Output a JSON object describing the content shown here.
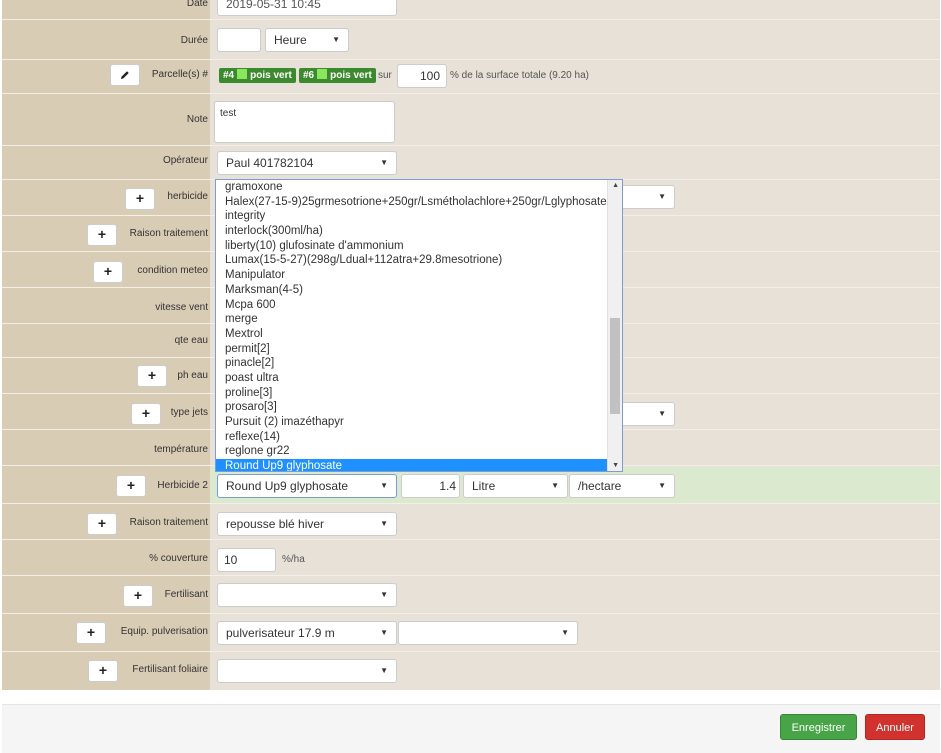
{
  "form": {
    "date": {
      "label": "Date",
      "value": "2019-05-31 10:45"
    },
    "duree": {
      "label": "Durée",
      "value": "",
      "unit": "Heure"
    },
    "parcelles": {
      "label": "Parcelle(s) #",
      "badges": [
        {
          "id": "#4",
          "name": "pois vert"
        },
        {
          "id": "#6",
          "name": "pois vert"
        }
      ],
      "sur": "sur",
      "percent": "100",
      "suffix": "% de la surface totale (9.20 ha)"
    },
    "note": {
      "label": "Note",
      "value": "test"
    },
    "operateur": {
      "label": "Opérateur",
      "value": "Paul 401782104"
    },
    "herbicide": {
      "label": "herbicide"
    },
    "raison1": {
      "label": "Raison traitement"
    },
    "meteo": {
      "label": "condition meteo"
    },
    "vent": {
      "label": "vitesse vent"
    },
    "eau": {
      "label": "qte eau"
    },
    "ph": {
      "label": "ph eau"
    },
    "jets": {
      "label": "type jets"
    },
    "temp": {
      "label": "température"
    },
    "herbicide2": {
      "label": "Herbicide 2",
      "product": "Round Up9 glyphosate",
      "qty": "1.4",
      "unit": "Litre",
      "per": "/hectare"
    },
    "raison2": {
      "label": "Raison traitement",
      "value": "repousse blé hiver"
    },
    "couverture": {
      "label": "% couverture",
      "value": "10",
      "unit": "%/ha"
    },
    "fertilisant": {
      "label": "Fertilisant",
      "value": ""
    },
    "equip": {
      "label": "Equip. pulverisation",
      "value": "pulverisateur 17.9 m",
      "value2": ""
    },
    "foliaire": {
      "label": "Fertilisant foliaire",
      "value": ""
    }
  },
  "dropdown": {
    "options": [
      "gramoxone",
      "Halex(27-15-9)25grmesotrione+250gr/Lsmétholachlore+250gr/Lglyphosate",
      "integrity",
      "interlock(300ml/ha)",
      "liberty(10) glufosinate d'ammonium",
      "Lumax(15-5-27)(298g/Ldual+112atra+29.8mesotrione)",
      "Manipulator",
      "Marksman(4-5)",
      "Mcpa 600",
      "merge",
      "Mextrol",
      "permit[2]",
      "pinacle[2]",
      "poast ultra",
      "proline[3]",
      "prosaro[3]",
      "Pursuit (2) imazéthapyr",
      "reflexe(14)",
      "reglone gr22",
      "Round Up9 glyphosate"
    ],
    "selected": "Round Up9 glyphosate"
  },
  "buttons": {
    "save": "Enregistrer",
    "cancel": "Annuler"
  },
  "colors": {
    "label_bg": "#d8ccb5",
    "field_bg": "#e7e1d8",
    "highlight_row": "#dbe9cf",
    "save": "#47a447",
    "cancel": "#d2322d",
    "badge": "#3c8a2e"
  },
  "icons": {
    "edit": "pencil-icon",
    "add": "plus-icon",
    "caret": "caret-down-icon"
  }
}
